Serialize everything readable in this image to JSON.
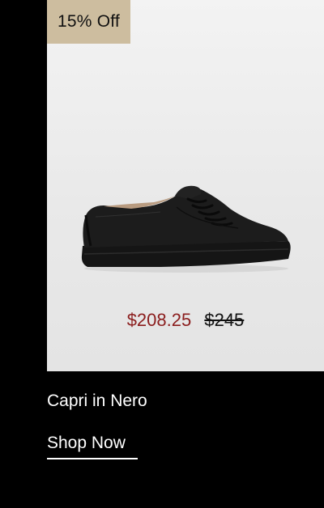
{
  "badge": {
    "label": "15% Off"
  },
  "product": {
    "name": "Capri in Nero",
    "sale_price": "$208.25",
    "original_price": "$245",
    "image_icon": "black-leather-sneaker"
  },
  "cta": {
    "label": "Shop Now"
  },
  "colors": {
    "background": "#000000",
    "card_background": "#ececec",
    "badge_background": "#cdbd9f",
    "sale_price": "#8b1d1d",
    "text_light": "#ffffff"
  }
}
